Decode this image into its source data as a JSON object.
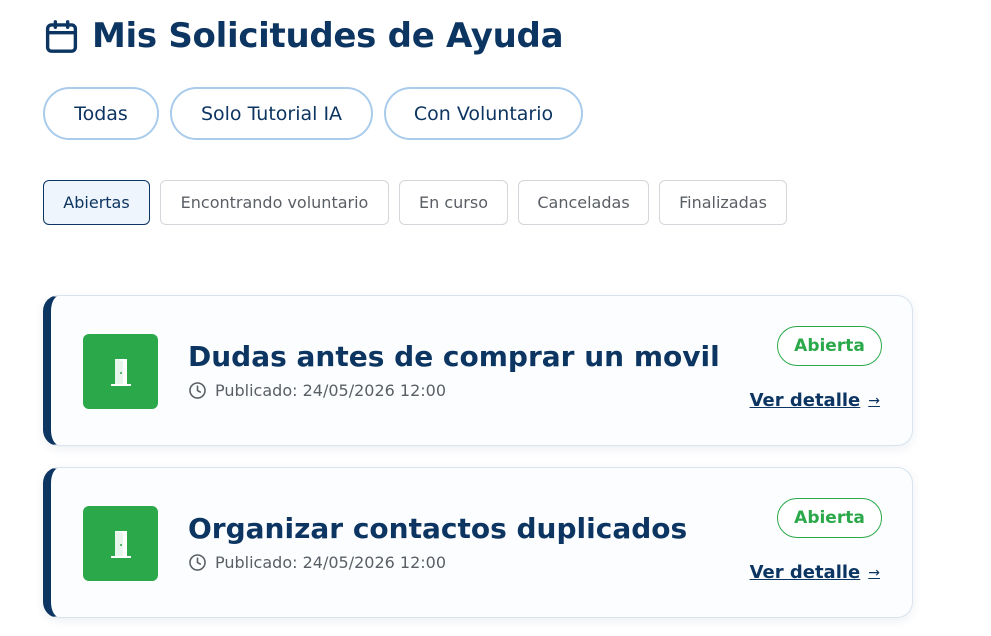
{
  "header": {
    "title": "Mis Solicitudes de Ayuda",
    "icon": "calendar-icon"
  },
  "type_filters": [
    "Todas",
    "Solo Tutorial IA",
    "Con Voluntario"
  ],
  "status_filters": {
    "items": [
      "Abiertas",
      "Encontrando voluntario",
      "En curso",
      "Canceladas",
      "Finalizadas"
    ],
    "selected": "Abiertas"
  },
  "colors": {
    "primary": "#0d3562",
    "success": "#2ba84a",
    "muted": "#5a5f65"
  },
  "requests": [
    {
      "title": "Dudas antes de comprar un movil",
      "published": "Publicado: 24/05/2026 12:00",
      "status": "Abierta",
      "detail_label": "Ver detalle",
      "icon": "door-icon"
    },
    {
      "title": "Organizar contactos duplicados",
      "published": "Publicado: 24/05/2026 12:00",
      "status": "Abierta",
      "detail_label": "Ver detalle",
      "icon": "door-icon"
    }
  ]
}
